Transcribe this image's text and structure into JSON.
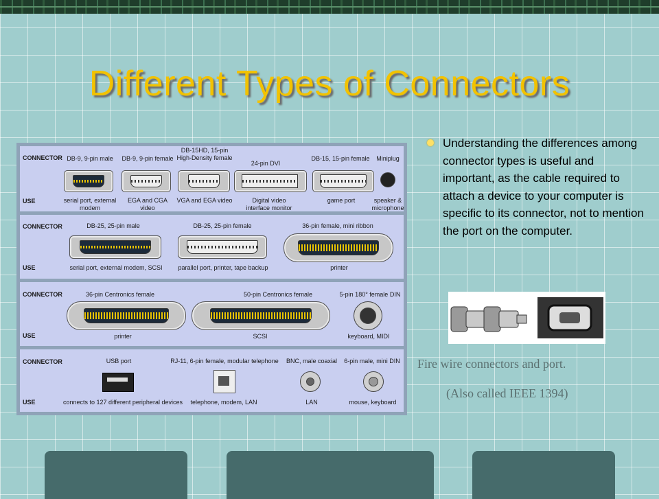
{
  "slide": {
    "title": "Different Types of Connectors",
    "bullet": "Understanding the differences among connector types is useful and important, as the cable required to attach a device to your computer is specific to its connector, not to mention the port on the computer."
  },
  "figure": {
    "row_labels": {
      "connector": "CONNECTOR",
      "use": "USE"
    },
    "rows": [
      {
        "connectors": [
          "DB-9, 9-pin male",
          "DB-9, 9-pin female",
          "DB-15HD, 15-pin High-Density female",
          "24-pin DVI",
          "DB-15, 15-pin female",
          "Miniplug"
        ],
        "uses": [
          "serial port, external modem",
          "EGA and CGA video",
          "VGA and EGA video",
          "Digital video interface monitor",
          "game port",
          "speaker & microphone"
        ]
      },
      {
        "connectors": [
          "DB-25, 25-pin male",
          "DB-25, 25-pin female",
          "36-pin female, mini ribbon"
        ],
        "uses": [
          "serial port, external modem, SCSI",
          "parallel port, printer, tape backup",
          "printer"
        ]
      },
      {
        "connectors": [
          "36-pin Centronics female",
          "50-pin Centronics female",
          "5-pin 180° female DIN"
        ],
        "uses": [
          "printer",
          "SCSI",
          "keyboard, MIDI"
        ]
      },
      {
        "connectors": [
          "USB port",
          "RJ-11, 6-pin female, modular telephone",
          "BNC, male coaxial",
          "6-pin male, mini DIN"
        ],
        "uses": [
          "connects to 127 different peripheral devices",
          "telephone, modem, LAN",
          "LAN",
          "mouse, keyboard"
        ]
      }
    ]
  },
  "firewire": {
    "caption_line1": "Fire wire connectors and port.",
    "caption_line2": "(Also called IEEE 1394)"
  },
  "colors": {
    "title": "#f2c200",
    "background": "#9fcdcd",
    "tabs": "#466b6b"
  }
}
